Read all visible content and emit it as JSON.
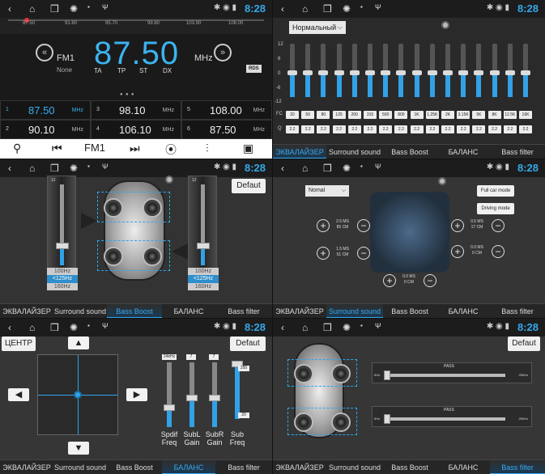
{
  "status": {
    "time": "8:28"
  },
  "radio": {
    "scale": [
      "87.50",
      "91.60",
      "95.70",
      "99.80",
      "103.90",
      "108.00"
    ],
    "band": "FM1",
    "pty": "None",
    "freq": "87.50",
    "unit": "MHz",
    "rds": "RDS",
    "flags": [
      "TA",
      "TP",
      "ST",
      "DX"
    ],
    "presets": [
      {
        "n": "1",
        "f": "87.50",
        "u": "MHz"
      },
      {
        "n": "3",
        "f": "98.10",
        "u": "MHz"
      },
      {
        "n": "5",
        "f": "108.00",
        "u": "MHz"
      },
      {
        "n": "2",
        "f": "90.10",
        "u": "MHz"
      },
      {
        "n": "4",
        "f": "106.10",
        "u": "MHz"
      },
      {
        "n": "6",
        "f": "87.50",
        "u": "MHz"
      }
    ],
    "ctrl_band": "FM1"
  },
  "eq": {
    "preset": "Нормальный",
    "scale": [
      "12",
      "6",
      "0",
      "-6",
      "-12"
    ],
    "fc_label": "FC",
    "q_label": "Q",
    "bands": [
      "20",
      "50",
      "80",
      "125",
      "200",
      "315",
      "500",
      "800",
      "1K",
      "1.25K",
      "2K",
      "3.15K",
      "5K",
      "8K",
      "12.5K",
      "16K"
    ],
    "q": [
      "2.2",
      "2.2",
      "2.2",
      "2.2",
      "2.2",
      "2.2",
      "2.2",
      "2.2",
      "2.2",
      "2.2",
      "2.2",
      "2.2",
      "2.2",
      "2.2",
      "2.2",
      "2.2"
    ],
    "levels": [
      0.45,
      0.45,
      0.45,
      0.45,
      0.45,
      0.45,
      0.45,
      0.45,
      0.45,
      0.45,
      0.45,
      0.45,
      0.45,
      0.45,
      0.45,
      0.45
    ]
  },
  "tabs": [
    "ЭКВАЛАЙЗЕР",
    "Surround sound",
    "Bass Boost",
    "БАЛАНС",
    "Bass filter"
  ],
  "bass": {
    "default": "Defaut",
    "scale_top": "12",
    "opts": [
      "100Hz",
      "<125Hz",
      "160Hz"
    ]
  },
  "surround": {
    "mode": "Nomal",
    "full_car": "Full car mode",
    "driving": "Driving mode",
    "fl": {
      "ms": "2.5 MS",
      "cm": "85 CM"
    },
    "fr": {
      "ms": "0.5 MS",
      "cm": "17 CM"
    },
    "rl": {
      "ms": "1.5 MS",
      "cm": "51 CM"
    },
    "rr": {
      "ms": "0.0 MS",
      "cm": "0 CM"
    },
    "sub": {
      "ms": "0.0 MS",
      "cm": "0 CM"
    }
  },
  "balance": {
    "center": "ЦЕНТР",
    "default": "Defaut",
    "sliders": [
      {
        "val": "24kHz",
        "label": "Spdif\nFreq",
        "level": 0.3
      },
      {
        "val": "7",
        "label": "SubL\nGain",
        "level": 0.45
      },
      {
        "val": "7",
        "label": "SubR\nGain",
        "level": 0.45
      },
      {
        "val": "250",
        "label": "Sub\nFreq",
        "level": 1.0
      }
    ],
    "sub_low": "20"
  },
  "filter": {
    "default": "Defaut",
    "pass": "PASS",
    "lo": "0Hz",
    "hi": "250Hz",
    "hi2": "250Hz"
  }
}
